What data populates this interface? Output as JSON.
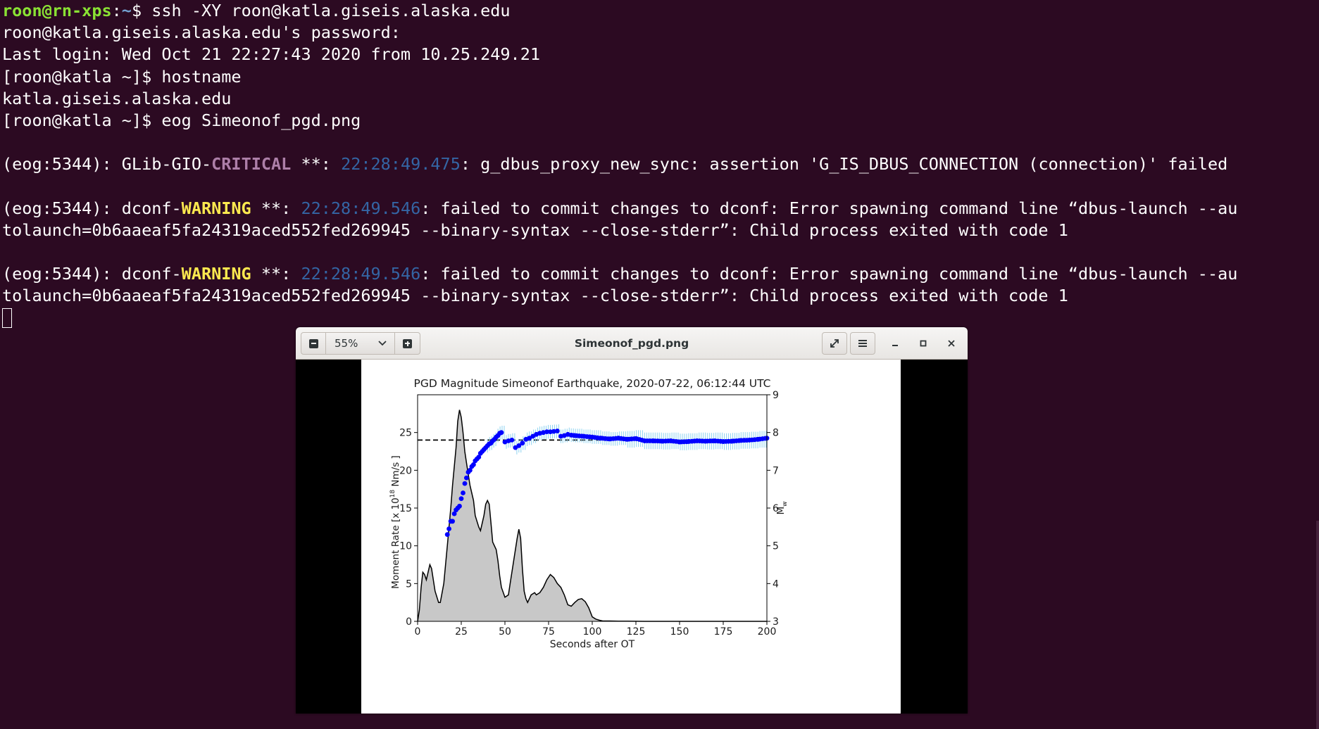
{
  "terminal": {
    "lines": [
      {
        "segments": [
          {
            "text": "roon@rn-xps",
            "cls": "user"
          },
          {
            "text": ":",
            "cls": ""
          },
          {
            "text": "~",
            "cls": "path"
          },
          {
            "text": "$ ssh -XY roon@katla.giseis.alaska.edu",
            "cls": ""
          }
        ]
      },
      {
        "segments": [
          {
            "text": "roon@katla.giseis.alaska.edu's password:",
            "cls": ""
          }
        ]
      },
      {
        "segments": [
          {
            "text": "Last login: Wed Oct 21 22:27:43 2020 from 10.25.249.21",
            "cls": ""
          }
        ]
      },
      {
        "segments": [
          {
            "text": "[roon@katla ~]$ hostname",
            "cls": ""
          }
        ]
      },
      {
        "segments": [
          {
            "text": "katla.giseis.alaska.edu",
            "cls": ""
          }
        ]
      },
      {
        "segments": [
          {
            "text": "[roon@katla ~]$ eog Simeonof_pgd.png",
            "cls": ""
          }
        ]
      },
      {
        "segments": []
      },
      {
        "segments": [
          {
            "text": "(eog:5344): GLib-GIO-",
            "cls": ""
          },
          {
            "text": "CRITICAL",
            "cls": "crit"
          },
          {
            "text": " **: ",
            "cls": ""
          },
          {
            "text": "22:28:49.475",
            "cls": "ts"
          },
          {
            "text": ": g_dbus_proxy_new_sync: assertion 'G_IS_DBUS_CONNECTION (connection)' failed",
            "cls": ""
          }
        ]
      },
      {
        "segments": []
      },
      {
        "segments": [
          {
            "text": "(eog:5344): dconf-",
            "cls": ""
          },
          {
            "text": "WARNING",
            "cls": "warn"
          },
          {
            "text": " **: ",
            "cls": ""
          },
          {
            "text": "22:28:49.546",
            "cls": "ts"
          },
          {
            "text": ": failed to commit changes to dconf: Error spawning command line “dbus-launch --au",
            "cls": ""
          }
        ]
      },
      {
        "segments": [
          {
            "text": "tolaunch=0b6aaeaf5fa24319aced552fed269945 --binary-syntax --close-stderr”: Child process exited with code 1",
            "cls": ""
          }
        ]
      },
      {
        "segments": []
      },
      {
        "segments": [
          {
            "text": "(eog:5344): dconf-",
            "cls": ""
          },
          {
            "text": "WARNING",
            "cls": "warn"
          },
          {
            "text": " **: ",
            "cls": ""
          },
          {
            "text": "22:28:49.546",
            "cls": "ts"
          },
          {
            "text": ": failed to commit changes to dconf: Error spawning command line “dbus-launch --au",
            "cls": ""
          }
        ]
      },
      {
        "segments": [
          {
            "text": "tolaunch=0b6aaeaf5fa24319aced552fed269945 --binary-syntax --close-stderr”: Child process exited with code 1",
            "cls": ""
          }
        ]
      }
    ]
  },
  "viewer": {
    "title": "Simeonof_pgd.png",
    "zoom": "55%",
    "icons": {
      "zoom_out": "zoom-out-icon",
      "zoom_in": "zoom-in-icon",
      "dropdown": "chevron-down-icon",
      "fullscreen": "fullscreen-icon",
      "menu": "hamburger-menu-icon",
      "minimize": "minimize-icon",
      "maximize": "maximize-icon",
      "close": "close-icon"
    }
  },
  "chart_data": {
    "type": "area",
    "title": "PGD Magnitude Simeonof Earthquake, 2020-07-22, 06:12:44 UTC",
    "xlabel": "Seconds after OT",
    "ylabel_left": "Moment Rate [x 10",
    "ylabel_left_sup": "18",
    "ylabel_left_tail": " Nm/s ]",
    "ylabel_right": "M",
    "ylabel_right_sub": "w",
    "xlim": [
      0,
      200
    ],
    "ylim_left": [
      0,
      30
    ],
    "ylim_right": [
      3,
      9
    ],
    "x_ticks": [
      "0",
      "25",
      "50",
      "75",
      "100",
      "125",
      "150",
      "175",
      "200"
    ],
    "y_left_ticks": [
      "0",
      "5",
      "10",
      "15",
      "20",
      "25"
    ],
    "y_right_ticks": [
      "3",
      "4",
      "5",
      "6",
      "7",
      "8",
      "9"
    ],
    "reference_line_mw": 7.8,
    "colors": {
      "fill": "#c8c8c8",
      "line": "#000000",
      "points": "#0000ff",
      "errorbars": "#8fd3f0"
    },
    "series": [
      {
        "kind": "moment_rate",
        "x": [
          0,
          1,
          2,
          3,
          4,
          5,
          6,
          7,
          8,
          10,
          12,
          13,
          15,
          17,
          19,
          20,
          21,
          22,
          23,
          24,
          25,
          26,
          27,
          28,
          30,
          32,
          33,
          35,
          36,
          38,
          39,
          40,
          41,
          42,
          43,
          45,
          46,
          47,
          48,
          50,
          52,
          53,
          55,
          57,
          58,
          59,
          60,
          61,
          62,
          63,
          65,
          67,
          68,
          70,
          72,
          74,
          76,
          78,
          80,
          82,
          84,
          86,
          88,
          90,
          92,
          94,
          96,
          98,
          100,
          102,
          104,
          106,
          110,
          115,
          120,
          130,
          150,
          200
        ],
        "y": [
          0,
          1.5,
          4.5,
          6.5,
          6.2,
          5.5,
          6.5,
          7.5,
          7.0,
          4.0,
          2.5,
          2.5,
          5.0,
          10.0,
          15.0,
          18.0,
          20.5,
          23.0,
          26.5,
          28.0,
          27.0,
          25.0,
          22.5,
          21.0,
          18.0,
          16.0,
          14.0,
          12.5,
          12.0,
          14.0,
          15.5,
          16.0,
          15.5,
          13.0,
          10.5,
          9.5,
          8.0,
          6.0,
          4.5,
          3.2,
          3.5,
          5.0,
          8.0,
          11.0,
          12.2,
          11.0,
          7.0,
          4.0,
          3.0,
          2.5,
          3.5,
          3.8,
          3.5,
          3.8,
          4.5,
          5.5,
          6.2,
          5.8,
          5.0,
          4.5,
          3.5,
          2.2,
          2.0,
          2.5,
          2.9,
          3.0,
          2.6,
          1.8,
          0.6,
          0.3,
          0.15,
          0.05,
          0.05,
          0.03,
          0.02,
          0,
          0,
          0
        ]
      },
      {
        "kind": "pgd_magnitude",
        "x": [
          17,
          18,
          19,
          20,
          21,
          22,
          23,
          24,
          25,
          26,
          27,
          28,
          29,
          30,
          31,
          32,
          33,
          34,
          35,
          36,
          37,
          38,
          39,
          40,
          41,
          42,
          43,
          44,
          45,
          46,
          47,
          48,
          50,
          52,
          54,
          56,
          58,
          60,
          62,
          64,
          66,
          68,
          70,
          72,
          74,
          76,
          78,
          80,
          82,
          84,
          86,
          88,
          90,
          95,
          100,
          105,
          110,
          115,
          120,
          125,
          130,
          135,
          140,
          145,
          150,
          155,
          160,
          165,
          170,
          175,
          180,
          185,
          190,
          195,
          200
        ],
        "y": [
          5.3,
          5.45,
          5.65,
          5.65,
          5.85,
          5.95,
          6.0,
          6.05,
          6.25,
          6.4,
          6.65,
          6.8,
          6.95,
          7.0,
          7.1,
          7.15,
          7.25,
          7.3,
          7.35,
          7.45,
          7.5,
          7.55,
          7.6,
          7.65,
          7.7,
          7.72,
          7.78,
          7.82,
          7.88,
          7.92,
          7.98,
          8.0,
          7.75,
          7.78,
          7.8,
          7.6,
          7.65,
          7.72,
          7.82,
          7.85,
          7.9,
          7.95,
          7.98,
          8.0,
          8.02,
          8.02,
          8.03,
          8.04,
          7.9,
          7.92,
          7.95,
          7.93,
          7.92,
          7.9,
          7.88,
          7.85,
          7.83,
          7.85,
          7.82,
          7.84,
          7.78,
          7.78,
          7.77,
          7.78,
          7.75,
          7.76,
          7.78,
          7.77,
          7.78,
          7.76,
          7.77,
          7.79,
          7.8,
          7.82,
          7.85
        ]
      }
    ]
  }
}
